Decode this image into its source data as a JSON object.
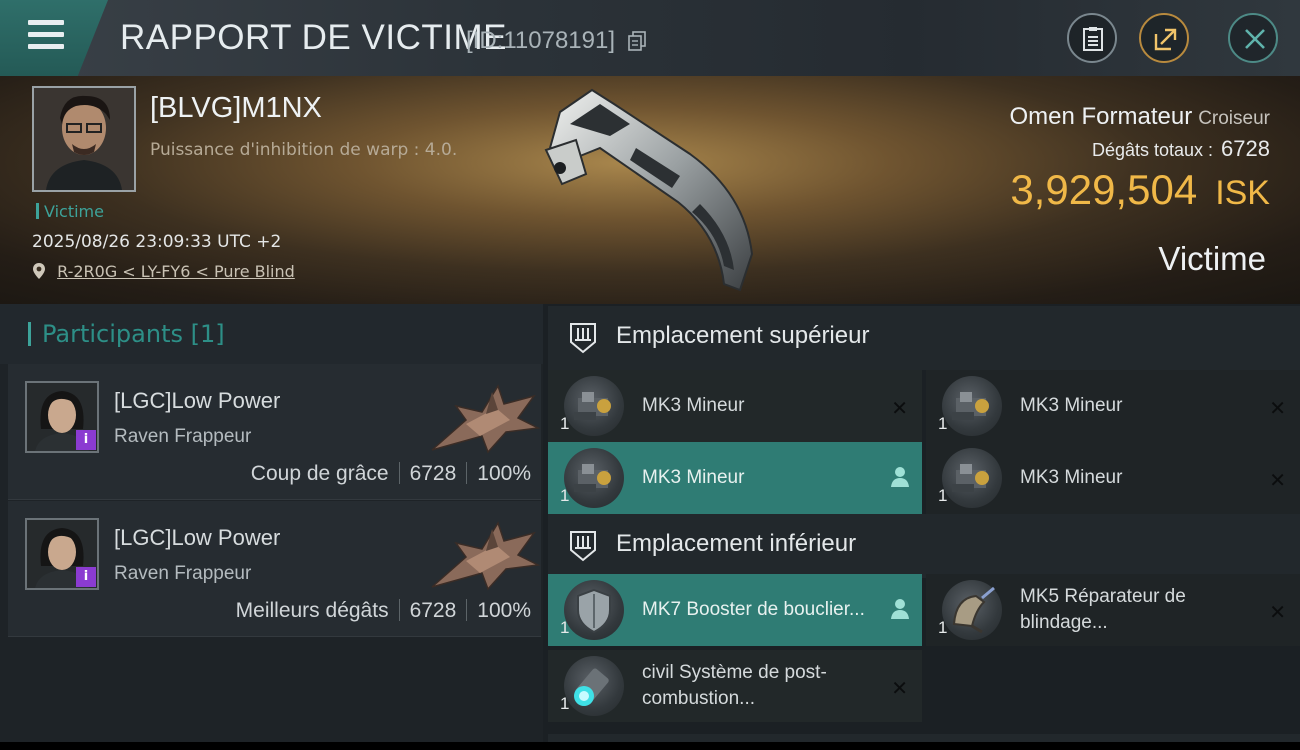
{
  "header": {
    "title": "RAPPORT DE VICTIME",
    "report_id": "[ID:11078191]"
  },
  "victim": {
    "name": "[BLVG]M1NX",
    "subtitle": "Puissance d'inhibition de warp : 4.0.",
    "tag": "Victime",
    "datetime": "2025/08/26 23:09:33 UTC +2",
    "location": "R-2R0G < LY-FY6 < Pure Blind",
    "ship_name": "Omen Formateur",
    "ship_class": "Croiseur",
    "damage_label": "Dégâts totaux :",
    "damage_value": "6728",
    "isk_value": "3,929,504",
    "isk_currency": "ISK",
    "role_label": "Victime"
  },
  "participants": {
    "title": "Participants [1]",
    "rows": [
      {
        "name": "[LGC]Low Power",
        "ship": "Raven Frappeur",
        "label": "Coup de grâce",
        "damage": "6728",
        "percent": "100%",
        "badge": "i"
      },
      {
        "name": "[LGC]Low Power",
        "ship": "Raven Frappeur",
        "label": "Meilleurs dégâts",
        "damage": "6728",
        "percent": "100%",
        "badge": "i"
      }
    ]
  },
  "slots": {
    "upper_title": "Emplacement supérieur",
    "lower_title": "Emplacement inférieur",
    "upper": [
      {
        "qty": "1",
        "name": "MK3 Mineur"
      },
      {
        "qty": "1",
        "name": "MK3 Mineur"
      },
      {
        "qty": "1",
        "name": "MK3 Mineur"
      },
      {
        "qty": "1",
        "name": "MK3 Mineur"
      }
    ],
    "lower": [
      {
        "qty": "1",
        "name": "MK7 Booster de bouclier..."
      },
      {
        "qty": "1",
        "name": "MK5 Réparateur de blindage..."
      },
      {
        "qty": "1",
        "name": "civil Système de post-combustion..."
      }
    ],
    "close_glyph": "✕"
  },
  "colors": {
    "accent_teal": "#2f7c74",
    "isk_gold": "#f0b848",
    "badge_purple": "#8b3bd1"
  }
}
